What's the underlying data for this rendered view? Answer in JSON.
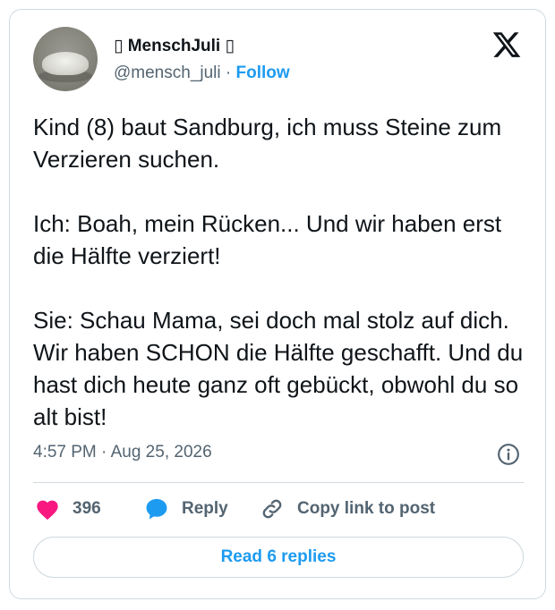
{
  "author": {
    "display_name": "▯ MenschJuli ▯",
    "handle": "@mensch_juli",
    "separator": "·",
    "follow_label": "Follow"
  },
  "tweet": {
    "text": "Kind (8) baut Sandburg, ich muss Steine zum Verzieren suchen.\n\nIch: Boah, mein Rücken... Und wir haben erst die Hälfte verziert!\n\nSie: Schau Mama, sei doch mal stolz auf dich. Wir haben SCHON die Hälfte geschafft. Und du hast dich heute ganz oft gebückt, obwohl du so alt bist!",
    "timestamp": "4:57 PM · Aug 25, 2026"
  },
  "actions": {
    "like_count": "396",
    "reply_label": "Reply",
    "copy_link_label": "Copy link to post",
    "read_replies_label": "Read 6 replies"
  },
  "icons": {
    "logo": "x-logo-icon",
    "info": "info-icon",
    "like": "heart-icon",
    "reply": "speech-bubble-icon",
    "copy": "link-icon"
  },
  "colors": {
    "accent": "#1d9bf0",
    "like": "#f91880",
    "text": "#0f1419",
    "muted": "#536471",
    "border": "#cfd9de"
  }
}
